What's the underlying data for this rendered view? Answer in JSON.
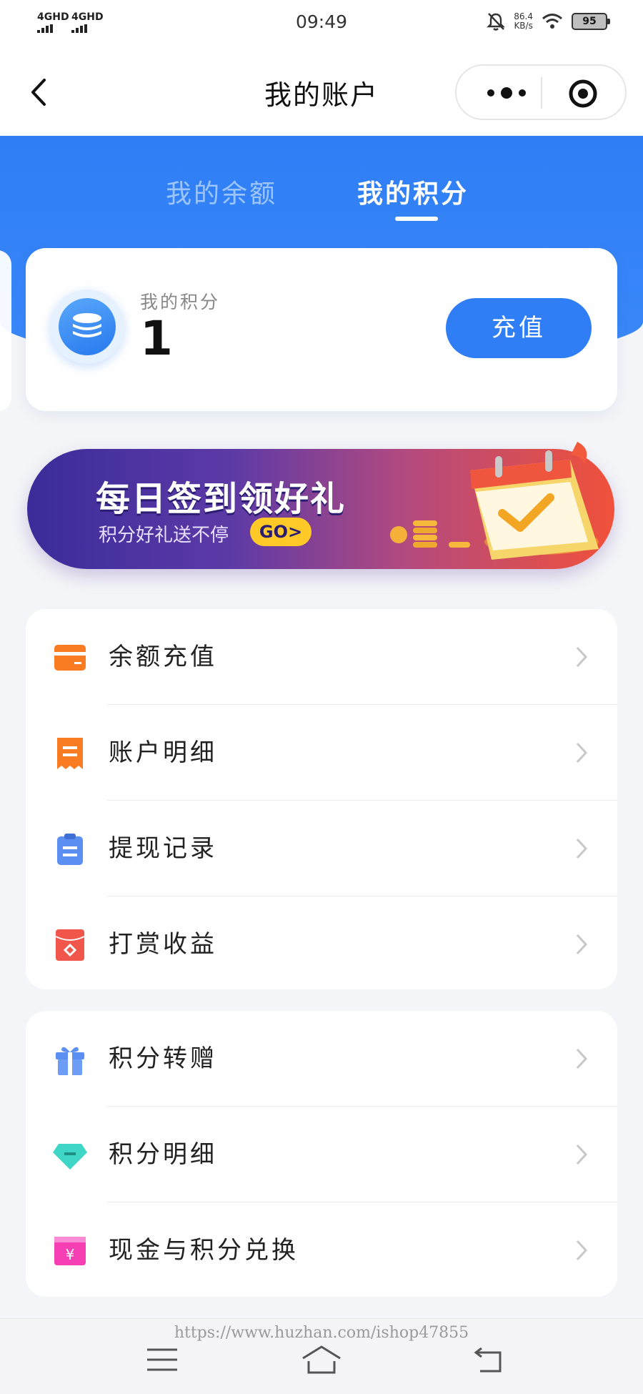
{
  "status": {
    "signal_1": "4GHD",
    "signal_2": "4GHD",
    "time": "09:49",
    "net_speed_value": "86.4",
    "net_speed_unit": "KB/s",
    "battery": "95"
  },
  "nav": {
    "title": "我的账户"
  },
  "tabs": [
    {
      "label": "我的余额",
      "active": false
    },
    {
      "label": "我的积分",
      "active": true
    }
  ],
  "points_card": {
    "label": "我的积分",
    "value": "1",
    "recharge_label": "充值"
  },
  "banner": {
    "title": "每日签到领好礼",
    "subtitle": "积分好礼送不停",
    "go": "GO>"
  },
  "menu_group_1": [
    {
      "label": "余额充值",
      "icon": "card-icon"
    },
    {
      "label": "账户明细",
      "icon": "receipt-icon"
    },
    {
      "label": "提现记录",
      "icon": "clipboard-icon"
    },
    {
      "label": "打赏收益",
      "icon": "red-envelope-icon"
    }
  ],
  "menu_group_2": [
    {
      "label": "积分转赠",
      "icon": "gift-icon"
    },
    {
      "label": "积分明细",
      "icon": "diamond-icon"
    },
    {
      "label": "现金与积分兑换",
      "icon": "yen-icon"
    }
  ],
  "watermark": "https://www.huzhan.com/ishop47855",
  "colors": {
    "primary": "#2f7ef5",
    "background": "#f4f5f8",
    "card_icon": "#f97b22",
    "receipt_icon": "#f97b22",
    "clipboard_icon": "#5b8ff2",
    "envelope_icon": "#f0564a",
    "gift_icon": "#5b8ff2",
    "diamond_icon": "#3fd6c8",
    "yen_icon": "#f73fb4"
  }
}
